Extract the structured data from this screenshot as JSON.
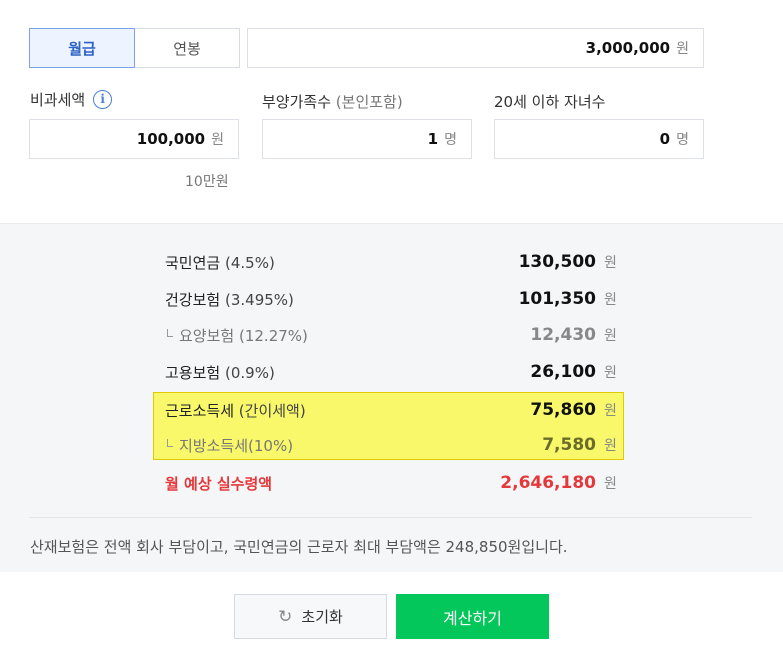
{
  "tabs": {
    "monthly": "월급",
    "annual": "연봉"
  },
  "salary": {
    "value": "3,000,000",
    "unit": "원"
  },
  "nontaxable": {
    "label": "비과세액",
    "info_icon": "info-icon",
    "value": "100,000",
    "unit": "원",
    "hint": "10만원"
  },
  "dependents": {
    "label": "부양가족수",
    "sub": "(본인포함)",
    "value": "1",
    "unit": "명"
  },
  "children": {
    "label": "20세 이하 자녀수",
    "value": "0",
    "unit": "명"
  },
  "results": {
    "pension": {
      "name": "국민연금",
      "pct": "(4.5%)",
      "value": "130,500",
      "unit": "원"
    },
    "health": {
      "name": "건강보험",
      "pct": "(3.495%)",
      "value": "101,350",
      "unit": "원"
    },
    "care": {
      "name": "요양보험",
      "pct": "(12.27%)",
      "value": "12,430",
      "unit": "원"
    },
    "employment": {
      "name": "고용보험",
      "pct": "(0.9%)",
      "value": "26,100",
      "unit": "원"
    },
    "income_tax": {
      "name": "근로소득세",
      "pct": "(간이세액)",
      "value": "75,860",
      "unit": "원"
    },
    "local_tax": {
      "name": "지방소득세(10%)",
      "value": "7,580",
      "unit": "원"
    },
    "net": {
      "name": "월 예상 실수령액",
      "value": "2,646,180",
      "unit": "원"
    }
  },
  "highlight_color": "#f8f86a",
  "accent_green": "#03c75a",
  "accent_red": "#e5383b",
  "note": "산재보험은 전액 회사 부담이고, 국민연금의 근로자 최대 부담액은 248,850원입니다.",
  "buttons": {
    "reset": "초기화",
    "reset_icon": "refresh-icon",
    "calculate": "계산하기"
  }
}
